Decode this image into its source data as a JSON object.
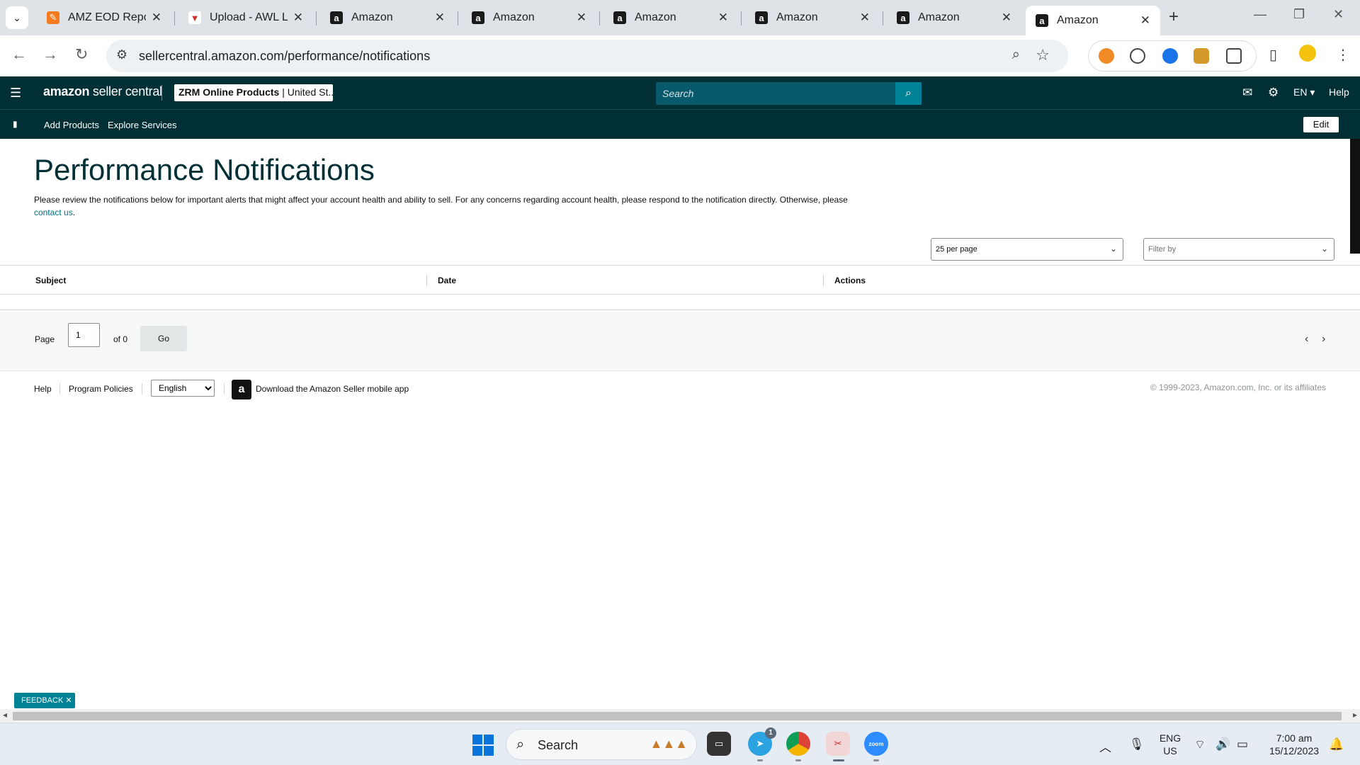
{
  "browser": {
    "tabs": [
      {
        "title": "AMZ EOD Repor",
        "icon": "amz-eod-favicon"
      },
      {
        "title": "Upload - AWL LA",
        "icon": "upload-favicon"
      },
      {
        "title": "Amazon",
        "icon": "amazon-favicon"
      },
      {
        "title": "Amazon",
        "icon": "amazon-favicon"
      },
      {
        "title": "Amazon",
        "icon": "amazon-favicon"
      },
      {
        "title": "Amazon",
        "icon": "amazon-favicon"
      },
      {
        "title": "Amazon",
        "icon": "amazon-favicon"
      },
      {
        "title": "Amazon",
        "icon": "amazon-favicon",
        "active": true
      }
    ],
    "url": "sellercentral.amazon.com/performance/notifications"
  },
  "header": {
    "logo_bold": "amazon",
    "logo_light": " seller central",
    "store_name": "ZRM Online Products",
    "store_region": "United St...",
    "search_placeholder": "Search",
    "language": "EN",
    "help": "Help",
    "accent": "#008296",
    "bg": "#002f36"
  },
  "subnav": {
    "items": [
      "Add Products",
      "Explore Services"
    ],
    "edit": "Edit"
  },
  "page": {
    "title": "Performance Notifications",
    "description": "Please review the notifications below for important alerts that might affect your account health and ability to sell. For any concerns regarding account health, please respond to the notification directly. Otherwise, please",
    "contact_link": "contact us",
    "per_page": "25 per page",
    "filter": "Filter by"
  },
  "table": {
    "columns": [
      "Subject",
      "Date",
      "Actions"
    ]
  },
  "pager": {
    "page_label": "Page",
    "page_value": "1",
    "of_label": "of 0",
    "go": "Go"
  },
  "footer": {
    "help": "Help",
    "policies": "Program Policies",
    "language": "English",
    "app_text": "Download the Amazon Seller mobile app",
    "copyright": "© 1999-2023, Amazon.com, Inc. or its affiliates"
  },
  "feedback": "FEEDBACK",
  "taskbar": {
    "search": "Search",
    "telegram_badge": "1",
    "lang": "ENG",
    "region": "US",
    "time": "7:00 am",
    "date": "15/12/2023"
  }
}
